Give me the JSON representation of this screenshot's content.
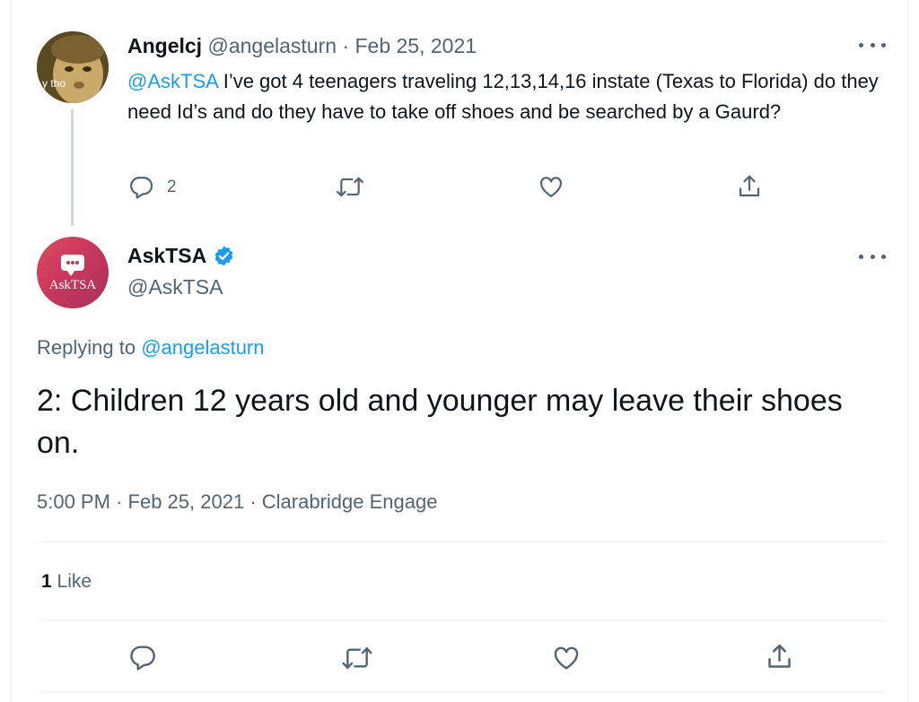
{
  "parent_tweet": {
    "avatar_caption": "y tho",
    "display_name": "Angelcj",
    "handle": "@angelasturn",
    "separator": "·",
    "date": "Feb 25, 2021",
    "mention": "@AskTSA",
    "text": " I’ve got 4 teenagers traveling 12,13,14,16 instate (Texas to Florida) do they need Id’s and do they have to take off shoes and be searched by a Gaurd?",
    "reply_count": "2",
    "icons": [
      "more-options-icon",
      "reply-icon",
      "retweet-icon",
      "like-icon",
      "share-icon"
    ]
  },
  "main_tweet": {
    "avatar_label": "AskTSA",
    "display_name": "AskTSA",
    "handle": "@AskTSA",
    "replying_prefix": "Replying to ",
    "replying_to": "@angelasturn",
    "text": "2: Children 12 years old and younger may leave their shoes on.",
    "time": "5:00 PM",
    "separator": "·",
    "date": "Feb 25, 2021",
    "source": "Clarabridge Engage",
    "like_count": "1",
    "like_label": " Like",
    "icons": [
      "verified-badge-icon",
      "more-options-icon",
      "reply-icon",
      "retweet-icon",
      "like-icon",
      "share-icon"
    ]
  },
  "colors": {
    "text": "#0f1419",
    "muted": "#536471",
    "link": "#1d9bf0",
    "thread_line": "#cfd9de",
    "divider": "#eff3f4",
    "avatar_gradient_start": "#e0475f",
    "avatar_gradient_end": "#a8325e"
  }
}
